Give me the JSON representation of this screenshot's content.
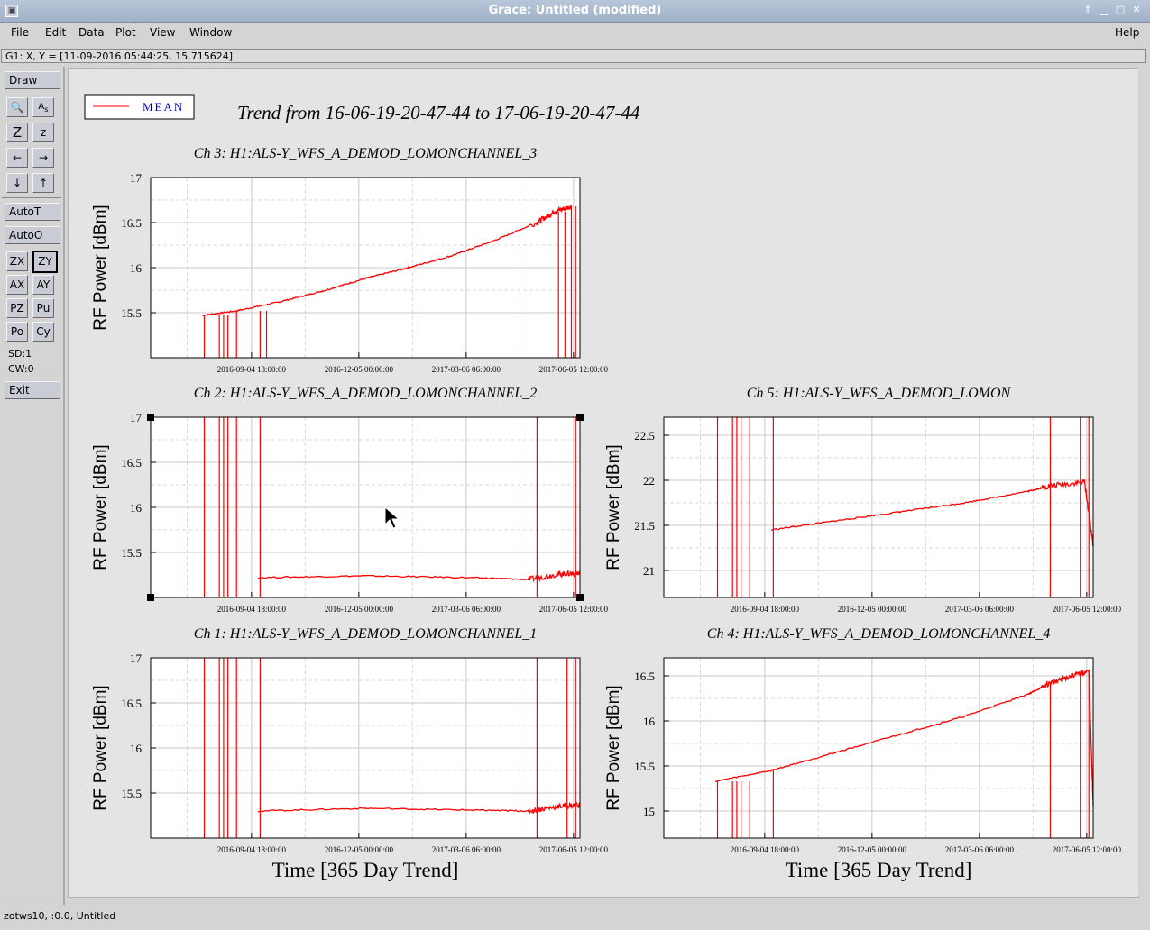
{
  "window": {
    "title": "Grace: Untitled (modified)"
  },
  "menu": [
    "File",
    "Edit",
    "Data",
    "Plot",
    "View",
    "Window",
    "Help"
  ],
  "locator": "G1: X, Y = [11-09-2016 05:44:25, 15.715624]",
  "toolbar": {
    "draw": "Draw",
    "autot": "AutoT",
    "autoo": "AutoO",
    "zx": "ZX",
    "zy": "ZY",
    "ax": "AX",
    "ay": "AY",
    "pz": "PZ",
    "pu": "Pu",
    "po": "Po",
    "cy": "Cy",
    "sd": "SD:1",
    "cw": "CW:0",
    "exit": "Exit"
  },
  "legend": "MEAN",
  "plot_title": "Trend from 16-06-19-20-47-44 to 17-06-19-20-47-44",
  "statusbar": "zotws10, :0.0, Untitled",
  "colors": {
    "series": "#ff0000",
    "grid": "#c8c8c8",
    "title_bar": "#9fb0c8"
  },
  "chart_data": [
    {
      "type": "line",
      "title": "Ch 3: H1:ALS-Y_WFS_A_DEMOD_LOMONCHANNEL_3",
      "ylabel": "RF Power [dBm]",
      "xlabel": "",
      "xticks": [
        "2016-09-04 18:00:00",
        "2016-12-05 00:00:00",
        "2017-03-06 06:00:00",
        "2017-06-05 12:00:00"
      ],
      "yticks": [
        "15.5",
        "16",
        "16.5",
        "17"
      ],
      "ylim": [
        15.0,
        17.0
      ],
      "series": [
        {
          "values": [
            [
              0.12,
              15.47
            ],
            [
              0.2,
              15.52
            ],
            [
              0.3,
              15.62
            ],
            [
              0.4,
              15.74
            ],
            [
              0.5,
              15.88
            ],
            [
              0.6,
              16.0
            ],
            [
              0.7,
              16.13
            ],
            [
              0.8,
              16.3
            ],
            [
              0.9,
              16.5
            ],
            [
              0.94,
              16.62
            ],
            [
              0.98,
              16.68
            ]
          ]
        }
      ]
    },
    {
      "type": "line",
      "title": "Ch 2: H1:ALS-Y_WFS_A_DEMOD_LOMONCHANNEL_2",
      "ylabel": "RF Power [dBm]",
      "xlabel": "",
      "xticks": [
        "2016-09-04 18:00:00",
        "2016-12-05 00:00:00",
        "2017-03-06 06:00:00",
        "2017-06-05 12:00:00"
      ],
      "yticks": [
        "15.5",
        "16",
        "16.5",
        "17"
      ],
      "ylim": [
        15.0,
        17.0
      ],
      "series": [
        {
          "values": [
            [
              0.25,
              15.22
            ],
            [
              0.5,
              15.24
            ],
            [
              0.75,
              15.22
            ],
            [
              0.88,
              15.2
            ],
            [
              0.95,
              15.26
            ],
            [
              1.0,
              15.27
            ]
          ]
        }
      ]
    },
    {
      "type": "line",
      "title": "Ch 5: H1:ALS-Y_WFS_A_DEMOD_LOMON",
      "ylabel": "RF Power [dBm]",
      "xlabel": "",
      "xticks": [
        "2016-09-04 18:00:00",
        "2016-12-05 00:00:00",
        "2017-03-06 06:00:00",
        "2017-06-05 12:00:00"
      ],
      "yticks": [
        "21",
        "21.5",
        "22",
        "22.5"
      ],
      "ylim": [
        20.7,
        22.7
      ],
      "series": [
        {
          "values": [
            [
              0.25,
              21.45
            ],
            [
              0.4,
              21.55
            ],
            [
              0.55,
              21.65
            ],
            [
              0.7,
              21.75
            ],
            [
              0.85,
              21.88
            ],
            [
              0.9,
              21.94
            ],
            [
              0.98,
              21.98
            ],
            [
              1.0,
              21.28
            ]
          ]
        }
      ]
    },
    {
      "type": "line",
      "title": "Ch 1: H1:ALS-Y_WFS_A_DEMOD_LOMONCHANNEL_1",
      "ylabel": "RF Power [dBm]",
      "xlabel": "Time [365 Day Trend]",
      "xticks": [
        "2016-09-04 18:00:00",
        "2016-12-05 00:00:00",
        "2017-03-06 06:00:00",
        "2017-06-05 12:00:00"
      ],
      "yticks": [
        "15.5",
        "16",
        "16.5",
        "17"
      ],
      "ylim": [
        15.0,
        17.0
      ],
      "series": [
        {
          "values": [
            [
              0.25,
              15.3
            ],
            [
              0.5,
              15.33
            ],
            [
              0.75,
              15.31
            ],
            [
              0.88,
              15.3
            ],
            [
              0.95,
              15.35
            ],
            [
              1.0,
              15.37
            ]
          ]
        }
      ]
    },
    {
      "type": "line",
      "title": "Ch 4: H1:ALS-Y_WFS_A_DEMOD_LOMONCHANNEL_4",
      "ylabel": "RF Power [dBm]",
      "xlabel": "Time [365 Day Trend]",
      "xticks": [
        "2016-09-04 18:00:00",
        "2016-12-05 00:00:00",
        "2017-03-06 06:00:00",
        "2017-06-05 12:00:00"
      ],
      "yticks": [
        "15",
        "15.5",
        "16",
        "16.5"
      ],
      "ylim": [
        14.7,
        16.7
      ],
      "series": [
        {
          "values": [
            [
              0.12,
              15.33
            ],
            [
              0.25,
              15.45
            ],
            [
              0.4,
              15.65
            ],
            [
              0.55,
              15.85
            ],
            [
              0.7,
              16.05
            ],
            [
              0.85,
              16.3
            ],
            [
              0.9,
              16.42
            ],
            [
              0.95,
              16.5
            ],
            [
              0.99,
              16.55
            ],
            [
              1.0,
              15.05
            ]
          ]
        }
      ]
    }
  ]
}
